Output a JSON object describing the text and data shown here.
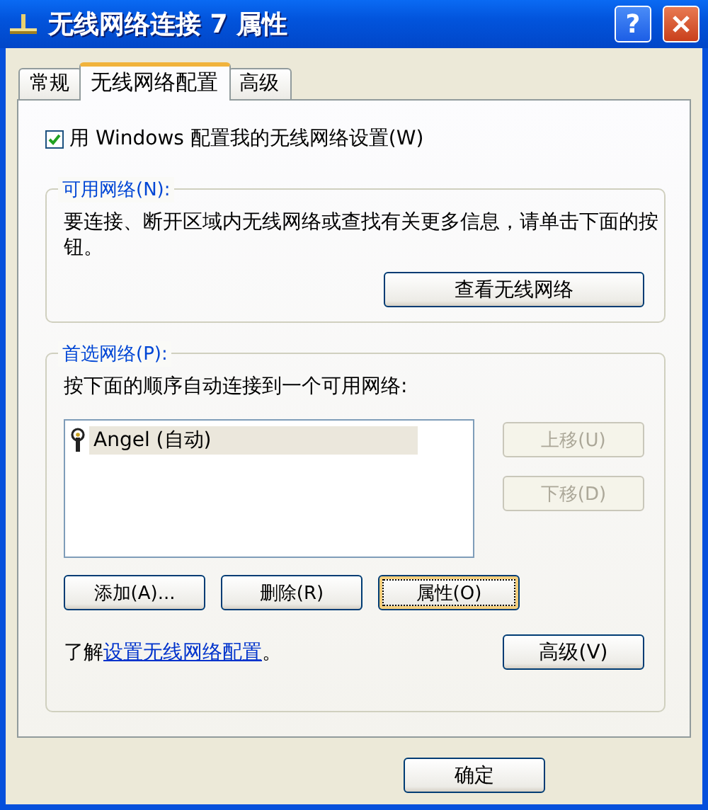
{
  "window": {
    "title": "无线网络连接 7 属性",
    "help_button": "?"
  },
  "tabs": [
    {
      "label": "常规",
      "selected": false
    },
    {
      "label": "无线网络配置",
      "selected": true
    },
    {
      "label": "高级",
      "selected": false
    }
  ],
  "use_windows": {
    "label": "用 Windows 配置我的无线网络设置(W)",
    "checked": true
  },
  "available": {
    "title": "可用网络(N):",
    "description": "要连接、断开区域内无线网络或查找有关更多信息，请单击下面的按钮。",
    "button": "查看无线网络"
  },
  "preferred": {
    "title": "首选网络(P):",
    "description": "按下面的顺序自动连接到一个可用网络:",
    "networks": [
      {
        "name": "Angel (自动)",
        "selected": true
      }
    ],
    "move_buttons": [
      {
        "label": "上移(U)",
        "disabled": true
      },
      {
        "label": "下移(D)",
        "disabled": true
      }
    ],
    "actions": [
      {
        "label": "添加(A)...",
        "focused": false
      },
      {
        "label": "删除(R)",
        "focused": false
      },
      {
        "label": "属性(O)",
        "focused": true
      }
    ],
    "learn": {
      "prefix": "了解",
      "link": "设置无线网络配置",
      "suffix": "。"
    },
    "advanced_button": "高级(V)"
  },
  "ok_button": "确定"
}
